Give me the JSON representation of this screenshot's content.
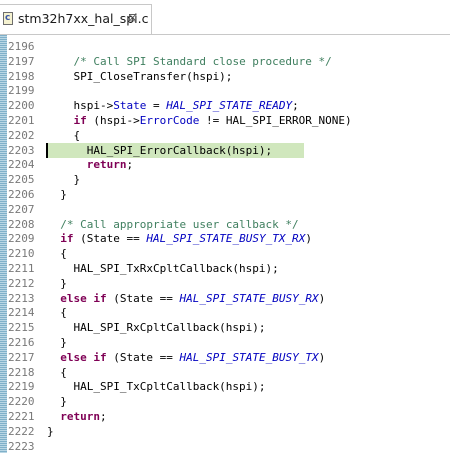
{
  "tab": {
    "title": "stm32h7xx_hal_spi.c",
    "icon_letter": "c",
    "close_glyph": "⊠"
  },
  "editor": {
    "current_line": "2203",
    "lines": [
      {
        "no": "2196",
        "code": ""
      },
      {
        "no": "2197",
        "code": "    /* Call SPI Standard close procedure */"
      },
      {
        "no": "2198",
        "code": "    SPI_CloseTransfer(hspi);"
      },
      {
        "no": "2199",
        "code": ""
      },
      {
        "no": "2200",
        "code": "    hspi->State = HAL_SPI_STATE_READY;"
      },
      {
        "no": "2201",
        "code": "    if (hspi->ErrorCode != HAL_SPI_ERROR_NONE)"
      },
      {
        "no": "2202",
        "code": "    {"
      },
      {
        "no": "2203",
        "code": "      HAL_SPI_ErrorCallback(hspi);"
      },
      {
        "no": "2204",
        "code": "      return;"
      },
      {
        "no": "2205",
        "code": "    }"
      },
      {
        "no": "2206",
        "code": "  }"
      },
      {
        "no": "2207",
        "code": ""
      },
      {
        "no": "2208",
        "code": "  /* Call appropriate user callback */"
      },
      {
        "no": "2209",
        "code": "  if (State == HAL_SPI_STATE_BUSY_TX_RX)"
      },
      {
        "no": "2210",
        "code": "  {"
      },
      {
        "no": "2211",
        "code": "    HAL_SPI_TxRxCpltCallback(hspi);"
      },
      {
        "no": "2212",
        "code": "  }"
      },
      {
        "no": "2213",
        "code": "  else if (State == HAL_SPI_STATE_BUSY_RX)"
      },
      {
        "no": "2214",
        "code": "  {"
      },
      {
        "no": "2215",
        "code": "    HAL_SPI_RxCpltCallback(hspi);"
      },
      {
        "no": "2216",
        "code": "  }"
      },
      {
        "no": "2217",
        "code": "  else if (State == HAL_SPI_STATE_BUSY_TX)"
      },
      {
        "no": "2218",
        "code": "  {"
      },
      {
        "no": "2219",
        "code": "    HAL_SPI_TxCpltCallback(hspi);"
      },
      {
        "no": "2220",
        "code": "  }"
      },
      {
        "no": "2221",
        "code": "  return;"
      },
      {
        "no": "2222",
        "code": "}"
      },
      {
        "no": "2223",
        "code": ""
      }
    ]
  },
  "colors": {
    "keyword": "#7f0055",
    "comment": "#3f7f5f",
    "enum_constant": "#0000c0",
    "current_line_highlight": "#d0e7bd",
    "gutter_stripe": "#7fb0c9"
  }
}
